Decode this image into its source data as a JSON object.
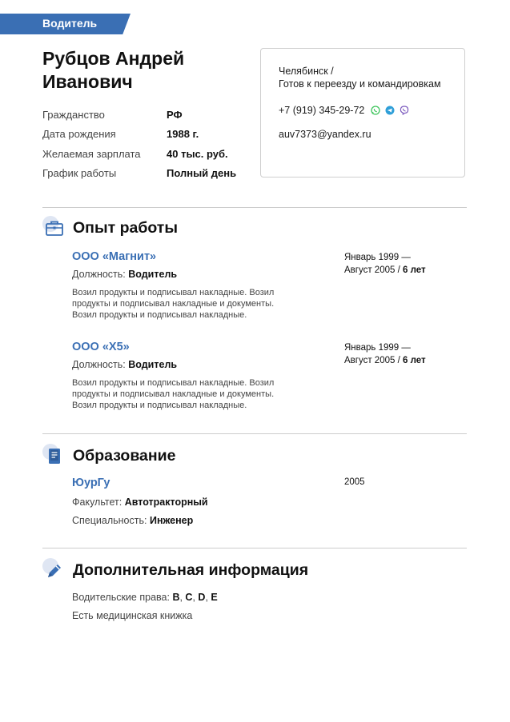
{
  "tag": "Водитель",
  "name": {
    "line1": "Рубцов Андрей",
    "line2": "Иванович"
  },
  "facts": [
    {
      "label": "Гражданство",
      "value": "РФ"
    },
    {
      "label": "Дата рождения",
      "value": "1988 г."
    },
    {
      "label": "Желаемая зарплата",
      "value": "40 тыс. руб."
    },
    {
      "label": "График работы",
      "value": "Полный день"
    }
  ],
  "contact": {
    "city": "Челябинск /",
    "relocation": "Готов к переезду и командировкам",
    "phone": "+7 (919) 345-29-72",
    "messengers": [
      "whatsapp-icon",
      "telegram-icon",
      "viber-icon"
    ],
    "email": "auv7373@yandex.ru"
  },
  "experience": {
    "title": "Опыт работы",
    "jobs": [
      {
        "company": "ООО «Магнит»",
        "position_label": "Должность:",
        "position": "Водитель",
        "description": "Возил продукты и подписывал накладные. Возил продукты и подписывал накладные и документы. Возил продукты и подписывал накладные.",
        "period_start": "Январь 1999 —",
        "period_end": "Август 2005 /",
        "duration": "6 лет"
      },
      {
        "company": "ООО «Х5»",
        "position_label": "Должность:",
        "position": "Водитель",
        "description": "Возил продукты и подписывал накладные. Возил продукты и подписывал накладные и документы. Возил продукты и подписывал накладные.",
        "period_start": "Январь 1999 —",
        "period_end": "Август 2005 /",
        "duration": "6 лет"
      }
    ]
  },
  "education": {
    "title": "Образование",
    "school": "ЮурГу",
    "year": "2005",
    "faculty_label": "Факультет:",
    "faculty": "Автотракторный",
    "specialty_label": "Специальность:",
    "specialty": "Инженер"
  },
  "additional": {
    "title": "Дополнительная информация",
    "license_label": "Водительские права:",
    "license_categories": [
      "B",
      "C",
      "D",
      "E"
    ],
    "sep": ", ",
    "medical": "Есть медицинская книжка"
  },
  "colors": {
    "accent": "#3a6fb4",
    "whatsapp": "#3cc45a",
    "telegram": "#2f9fd8",
    "viber": "#7d5bbe"
  }
}
